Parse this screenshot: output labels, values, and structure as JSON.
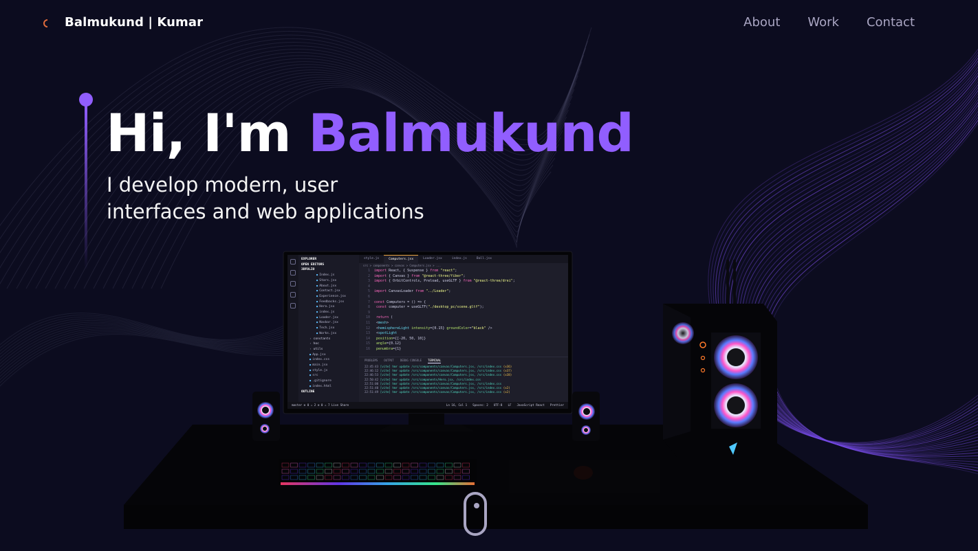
{
  "nav": {
    "brand": "Balmukund  | Kumar",
    "links": [
      {
        "label": "About"
      },
      {
        "label": "Work"
      },
      {
        "label": "Contact"
      }
    ]
  },
  "hero": {
    "greeting": "Hi, I'm ",
    "name": "Balmukund",
    "subtitle_line1": "I develop modern, user",
    "subtitle_line2": "interfaces and web applications"
  },
  "colors": {
    "background": "#0c0c1f",
    "accent": "#915eff",
    "nav_link": "#aaa6c3",
    "text": "#ffffff"
  },
  "scene": {
    "explorer": {
      "header1": "EXPLORER",
      "header2": "OPEN EDITORS",
      "header3": "3DFOLIO",
      "files": [
        "Index.js",
        "Stars.jsx",
        "About.jsx",
        "Contact.jsx",
        "Experience.jsx",
        "Feedbacks.jsx",
        "Hero.jsx",
        "index.js",
        "Loader.jsx",
        "Navbar.jsx",
        "Tech.jsx",
        "Works.jsx"
      ],
      "folders": [
        "constants",
        "hoc",
        "utils"
      ],
      "root_files": [
        "App.jsx",
        "index.css",
        "main.jsx",
        "style.js",
        "src",
        ".gitignore",
        "index.html"
      ],
      "outline": "OUTLINE"
    },
    "tabs": [
      "style.js",
      "Computers.jsx",
      "Loader.jsx",
      "index.js",
      "Ball.jsx"
    ],
    "crumb": "src > components > canvas > Computers.jsx > ...",
    "code_lines": [
      [
        "1",
        "import React, { Suspense } from \"react\";"
      ],
      [
        "2",
        "import { Canvas } from \"@react-three/fiber\";"
      ],
      [
        "3",
        "import { OrbitControls, Preload, useGLTF } from \"@react-three/drei\";"
      ],
      [
        "4",
        ""
      ],
      [
        "5",
        "import CanvasLoader from \"../Loader\";"
      ],
      [
        "6",
        ""
      ],
      [
        "7",
        "const Computers = () => {"
      ],
      [
        "8",
        "  const computer = useGLTF(\"./desktop_pc/scene.gltf\");"
      ],
      [
        "9",
        ""
      ],
      [
        "10",
        "  return ("
      ],
      [
        "11",
        "    <mesh>"
      ],
      [
        "12",
        "      <hemisphereLight intensity={0.15} groundColor=\"black\" />"
      ],
      [
        "13",
        "      <spotLight"
      ],
      [
        "14",
        "        position={[-20, 50, 10]}"
      ],
      [
        "15",
        "        angle={0.12}"
      ],
      [
        "16",
        "        penumbra={1}"
      ]
    ],
    "panel_tabs": [
      "PROBLEMS",
      "OUTPUT",
      "DEBUG CONSOLE",
      "TERMINAL"
    ],
    "terminal": [
      [
        "22:45:43",
        "[vite]",
        "hmr update /src/components/canvas/Computers.jsx, /src/index.css",
        "(x36)"
      ],
      [
        "22:46:12",
        "[vite]",
        "hmr update /src/components/canvas/Computers.jsx, /src/index.css",
        "(x37)"
      ],
      [
        "22:46:53",
        "[vite]",
        "hmr update /src/components/canvas/Computers.jsx, /src/index.css",
        "(x38)"
      ],
      [
        "22:50:42",
        "[vite]",
        "hmr update /src/components/Hero.jsx, /src/index.css",
        ""
      ],
      [
        "22:51:00",
        "[vite]",
        "hmr update /src/components/canvas/Computers.jsx, /src/index.css",
        ""
      ],
      [
        "22:51:40",
        "[vite]",
        "hmr update /src/components/canvas/Computers.jsx, /src/index.css",
        "(x2)"
      ],
      [
        "22:51:49",
        "[vite]",
        "hmr update /src/components/canvas/Computers.jsx, /src/index.css",
        "(x2)"
      ]
    ],
    "status_left": [
      "master",
      "⊗ 0 ⚠ 2",
      "⊗ 0 ⚠ 7",
      "Live Share"
    ],
    "status_right": [
      "Ln 16, Col 1",
      "Spaces: 2",
      "UTF-8",
      "LF",
      "JavaScript React",
      "Prettier"
    ]
  }
}
